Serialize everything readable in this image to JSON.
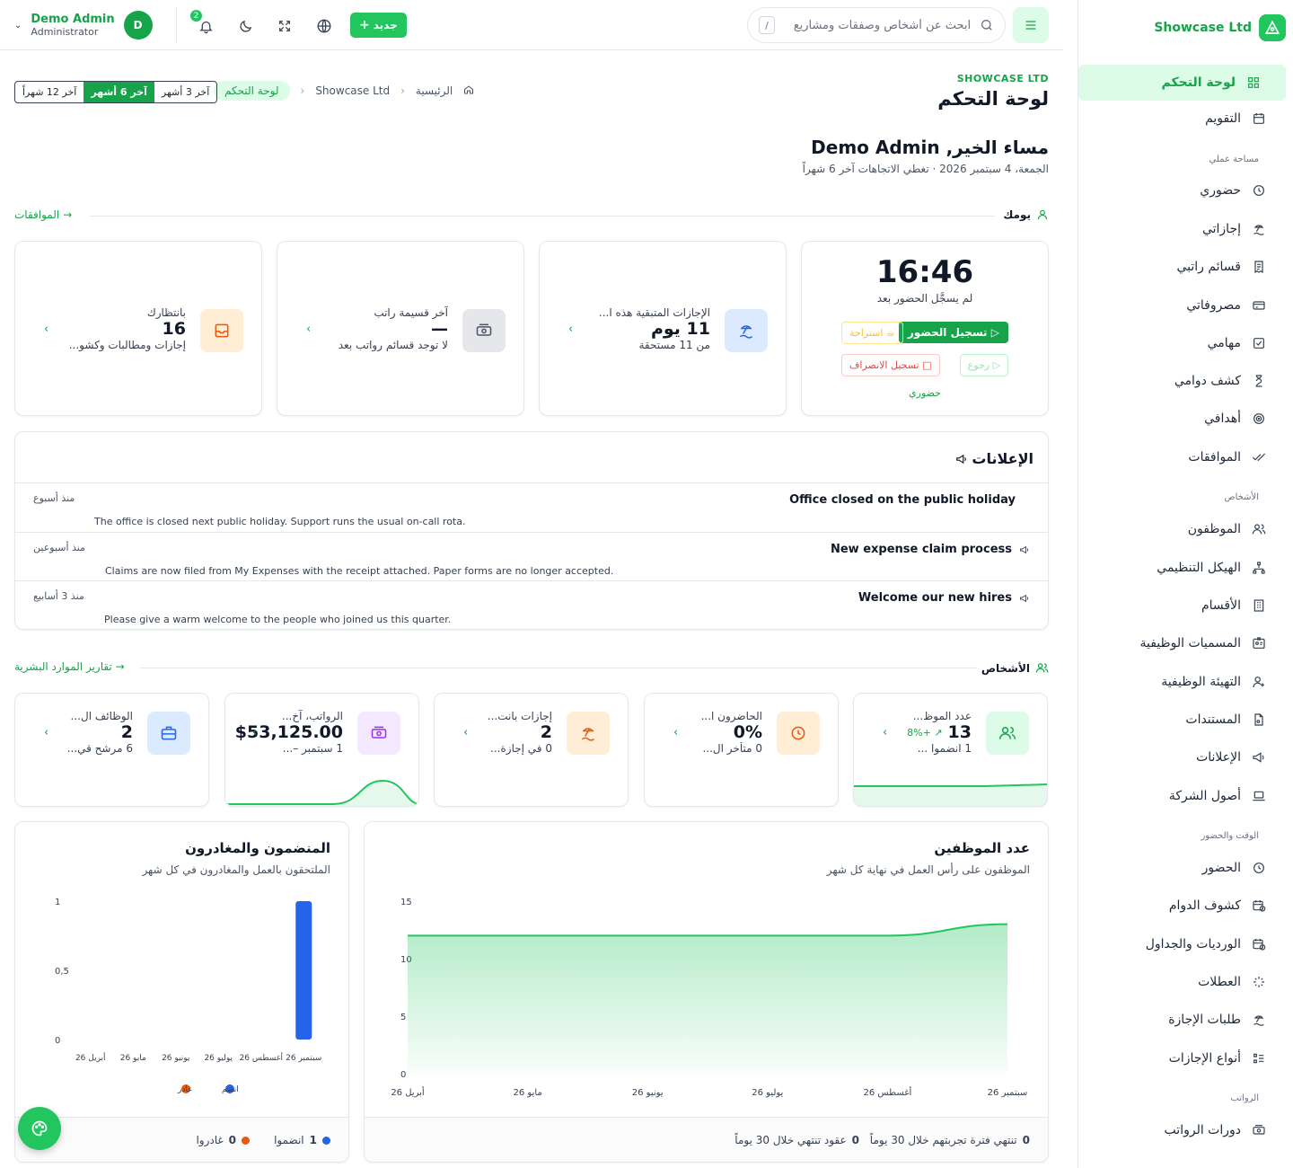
{
  "brand": {
    "name": "Showcase Ltd",
    "accent": "#22c55e"
  },
  "sidebar": {
    "items_top": [
      {
        "label": "لوحة التحكم",
        "icon": "grid-icon",
        "active": true
      },
      {
        "label": "التقويم",
        "icon": "calendar-icon"
      }
    ],
    "sections": [
      {
        "title": "مساحة عملي",
        "items": [
          {
            "label": "حضوري",
            "icon": "clock-icon"
          },
          {
            "label": "إجازاتي",
            "icon": "beach-icon"
          },
          {
            "label": "قسائم راتبي",
            "icon": "receipt-icon"
          },
          {
            "label": "مصروفاتي",
            "icon": "card-icon"
          },
          {
            "label": "مهامي",
            "icon": "check-square-icon"
          },
          {
            "label": "كشف دوامي",
            "icon": "hourglass-icon"
          },
          {
            "label": "أهدافي",
            "icon": "target-icon"
          },
          {
            "label": "الموافقات",
            "icon": "double-check-icon"
          }
        ]
      },
      {
        "title": "الأشخاص",
        "items": [
          {
            "label": "الموظفون",
            "icon": "users-icon"
          },
          {
            "label": "الهيكل التنظيمي",
            "icon": "org-chart-icon"
          },
          {
            "label": "الأقسام",
            "icon": "building-icon"
          },
          {
            "label": "المسميات الوظيفية",
            "icon": "id-badge-icon"
          },
          {
            "label": "التهيئة الوظيفية",
            "icon": "user-plus-icon"
          },
          {
            "label": "المستندات",
            "icon": "document-icon"
          },
          {
            "label": "الإعلانات",
            "icon": "megaphone-icon"
          },
          {
            "label": "أصول الشركة",
            "icon": "laptop-icon"
          }
        ]
      },
      {
        "title": "الوقت والحضور",
        "items": [
          {
            "label": "الحضور",
            "icon": "clock-icon"
          },
          {
            "label": "كشوف الدوام",
            "icon": "calendar-clock-icon"
          },
          {
            "label": "الورديات والجداول",
            "icon": "calendar-clock-icon"
          },
          {
            "label": "العطلات",
            "icon": "sparkle-icon"
          },
          {
            "label": "طلبات الإجازة",
            "icon": "beach-icon"
          },
          {
            "label": "أنواع الإجازات",
            "icon": "list-icon"
          }
        ]
      },
      {
        "title": "الرواتب",
        "items": [
          {
            "label": "دورات الرواتب",
            "icon": "money-icon"
          }
        ]
      }
    ]
  },
  "topbar": {
    "search_placeholder": "ابحث عن أشخاص وصفقات ومشاريع",
    "search_kbd": "/",
    "new_label": "جديد",
    "notif_count": "2",
    "user_name": "Demo Admin",
    "user_role": "Administrator",
    "user_initial": "D"
  },
  "header": {
    "company": "SHOWCASE LTD",
    "title": "لوحة التحكم",
    "breadcrumbs": [
      "الرئيسية",
      "Showcase Ltd",
      "لوحة التحكم"
    ],
    "ranges": [
      "آخر 3 أشهر",
      "آخر 6 أشهر",
      "آخر 12 شهراً"
    ],
    "range_selected": "آخر 6 أشهر"
  },
  "greeting": {
    "title": "مساء الخير, Demo Admin",
    "subtitle": "الجمعة، 4 سبتمبر 2026  ·  تغطي الاتجاهات آخر 6 شهراً"
  },
  "your_day": {
    "heading": "يومك",
    "link": "الموافقات",
    "clock": {
      "time": "16:46",
      "status": "لم يسجَّل الحضور بعد",
      "clock_in": "تسجيل الحضور",
      "break": "استراحة",
      "back": "رجوع",
      "clock_out": "تسجيل الانصراف",
      "link": "حضوري"
    },
    "cards": [
      {
        "label": "الإجازات المتبقية هذه ا...",
        "value": "11 يوم",
        "sub": "من 11 مستحقة",
        "icon": "beach-icon",
        "tint": "#dbeafe",
        "color": "#2563eb"
      },
      {
        "label": "آخر قسيمة راتب",
        "value": "—",
        "sub": "لا توجد قسائم رواتب بعد",
        "icon": "money-icon",
        "tint": "#e5e7eb",
        "color": "#4b5563"
      },
      {
        "label": "بانتظارك",
        "value": "16",
        "sub": "إجازات ومطالبات وكشو...",
        "icon": "inbox-icon",
        "tint": "#ffedd5",
        "color": "#ea580c"
      }
    ]
  },
  "announcements": {
    "title": "الإعلانات",
    "items": [
      {
        "title": "Office closed on the public holiday",
        "body": "The office is closed next public holiday. Support runs the usual on-call rota.",
        "time": "منذ أسبوع",
        "pinned": false
      },
      {
        "title": "New expense claim process",
        "body": "Claims are now filed from My Expenses with the receipt attached. Paper forms are no longer accepted.",
        "time": "منذ أسبوعين",
        "pinned": true
      },
      {
        "title": "Welcome our new hires",
        "body": "Please give a warm welcome to the people who joined us this quarter.",
        "time": "منذ 3 أسابيع",
        "pinned": true
      }
    ]
  },
  "people": {
    "heading": "الأشخاص",
    "link": "تقارير الموارد البشرية",
    "stats": [
      {
        "label": "عدد الموظ...",
        "value": "13",
        "delta": "+8%",
        "sub": "1 انضموا ...",
        "icon": "users-icon",
        "tint": "#dcfce7",
        "color": "#16a34a",
        "spark": [
          12,
          12,
          12,
          12,
          12,
          12.5,
          13
        ]
      },
      {
        "label": "الحاضرون ا...",
        "value": "0%",
        "sub": "0 متأخر ال...",
        "icon": "clock-icon",
        "tint": "#ffedd5",
        "color": "#ea580c"
      },
      {
        "label": "إجازات بانت...",
        "value": "2",
        "sub": "0 في إجازة...",
        "icon": "beach-icon",
        "tint": "#ffedd5",
        "color": "#ea580c"
      },
      {
        "label": "الرواتب، آخ...",
        "value": "$53,125.00",
        "sub": "1 سبتمبر –...",
        "icon": "money-icon",
        "tint": "#f3e8ff",
        "color": "#9333ea",
        "spark": [
          0,
          0,
          0,
          0,
          0,
          0,
          53125,
          0
        ]
      },
      {
        "label": "الوظائف ال...",
        "value": "2",
        "sub": "6 مرشح قي...",
        "icon": "briefcase-icon",
        "tint": "#dbeafe",
        "color": "#2563eb"
      }
    ]
  },
  "headcount": {
    "title": "عدد الموظفين",
    "subtitle": "الموظفون على رأس العمل في نهاية كل شهر",
    "footer": [
      {
        "value": "0",
        "label": "تنتهي فترة تجربتهم خلال 30 يوماً"
      },
      {
        "value": "0",
        "label": "عقود تنتهي خلال 30 يوماً"
      }
    ]
  },
  "joiners": {
    "title": "المنضمون والمغادرون",
    "subtitle": "الملتحقون بالعمل والمغادرون في كل شهر",
    "legend": [
      {
        "label": "انضم",
        "color": "#2563eb"
      },
      {
        "label": "غادر",
        "color": "#ea580c"
      }
    ],
    "footer": [
      {
        "value": "1",
        "label": "انضموا",
        "color": "#2563eb"
      },
      {
        "value": "0",
        "label": "غادروا",
        "color": "#ea580c"
      }
    ]
  },
  "chart_data": [
    {
      "type": "area",
      "title": "عدد الموظفين",
      "categories": [
        "أبريل 26",
        "مايو 26",
        "يونيو 26",
        "يوليو 26",
        "أغسطس 26",
        "سبتمبر 26"
      ],
      "series": [
        {
          "values": [
            12,
            12,
            12,
            12,
            12,
            13
          ]
        }
      ],
      "ylim": [
        0,
        15
      ],
      "yticks": [
        0,
        5,
        10,
        15
      ],
      "color": "#22c55e",
      "grid": false
    },
    {
      "type": "bar",
      "title": "المنضمون والمغادرون",
      "categories": [
        "أبريل 26",
        "مايو 26",
        "يونيو 26",
        "يوليو 26",
        "أغسطس 26",
        "سبتمبر 26"
      ],
      "series": [
        {
          "name": "انضم",
          "values": [
            0,
            0,
            0,
            0,
            0,
            1
          ]
        },
        {
          "name": "غادر",
          "values": [
            0,
            0,
            0,
            0,
            0,
            0
          ]
        }
      ],
      "ylim": [
        0,
        1
      ],
      "yticks": [
        "0",
        "0,5",
        "1"
      ],
      "legend": "bottom",
      "grid": false
    }
  ]
}
